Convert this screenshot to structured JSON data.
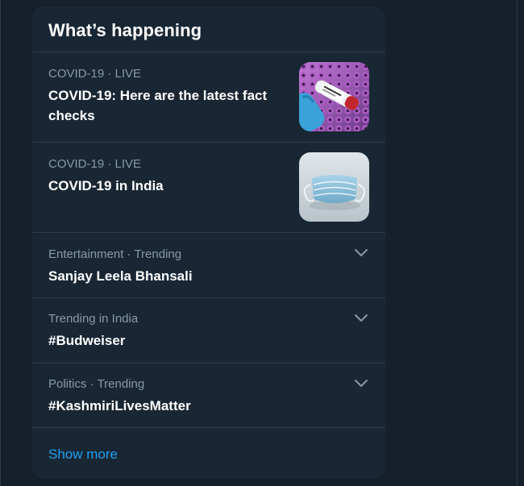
{
  "panel": {
    "title": "What’s happening",
    "show_more_label": "Show more"
  },
  "news": [
    {
      "meta": "COVID-19 · LIVE",
      "headline": "COVID-19: Here are the latest fact checks",
      "thumbnail": "covid-test-vials-photo"
    },
    {
      "meta": "COVID-19 · LIVE",
      "headline": "COVID-19 in India",
      "thumbnail": "face-mask-photo"
    }
  ],
  "trends": [
    {
      "meta": "Entertainment · Trending",
      "name": "Sanjay Leela Bhansali",
      "icon": "chevron-down-icon"
    },
    {
      "meta": "Trending in India",
      "name": "#Budweiser",
      "icon": "chevron-down-icon"
    },
    {
      "meta": "Politics · Trending",
      "name": "#KashmiriLivesMatter",
      "icon": "chevron-down-icon"
    }
  ],
  "colors": {
    "background": "#15202b",
    "panel": "#192734",
    "divider": "#2f3b47",
    "secondary_text": "#8899a6",
    "accent": "#1da1f2"
  }
}
